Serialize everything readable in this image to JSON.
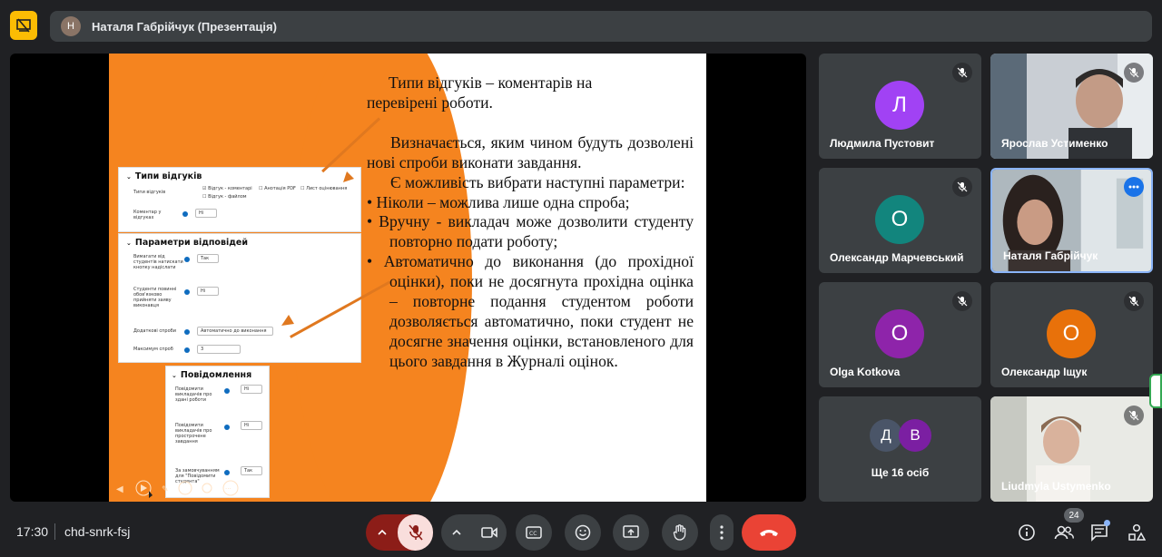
{
  "header": {
    "presenter_title": "Наталя Габрійчук (Презентація)",
    "presenting_icon": "stop-presenting-icon"
  },
  "slide": {
    "title_line1": "Типи відгуків – коментарів на",
    "title_line2": "перевірені роботи.",
    "para1": "Визначається, яким чином будуть дозволені нові спроби виконати завдання.",
    "para2": "Є можливість вибрати наступні параметри:",
    "bullets": [
      "•   Ніколи – можлива лише одна спроба;",
      "•   Вручну - викладач може дозволити студенту повторно подати роботу;",
      "•   Автоматично до виконання (до прохідної оцінки), поки не досягнута прохідна оцінка – повторне подання студентом роботи дозволяється автоматично, поки студент не досягне значення оцінки, встановленого для цього завдання в Журналі оцінок."
    ],
    "panel1": {
      "header": "Типи відгуків",
      "row1_label": "Типи відгуків",
      "check1": "Відгук - коментарі",
      "check2": "Анотація PDF",
      "check3": "Лист оцінювання",
      "check4": "Відгук - файлом",
      "row2_label": "Коментар у відгуках",
      "row2_value": "Ні"
    },
    "panel2": {
      "header": "Параметри відповідей",
      "row1_label": "Вимагати від студентів натискати кнопку надіслати",
      "row1_value": "Так",
      "row2_label": "Студенти повинні обов'язково прийняти заяву виконавця",
      "row2_value": "Ні",
      "row3_label": "Додаткові спроби",
      "row3_value": "Автоматично до виконання",
      "row4_label": "Максимум спроб",
      "row4_value": "3"
    },
    "panel3": {
      "header": "Повідомлення",
      "row1_label": "Повідомити викладачів про здані роботи",
      "row1_value": "Ні",
      "row2_label": "Повідомити викладачів про прострочене завдання",
      "row2_value": "Ні",
      "row3_label": "За замовчуванням для \"Повідомити студента\"",
      "row3_value": "Так"
    }
  },
  "participants": [
    {
      "name": "Людмила Пустовит",
      "initial": "Л",
      "color": "#a142f4",
      "muted": true
    },
    {
      "name": "Ярослав Устименко",
      "video": true,
      "muted": true
    },
    {
      "name": "Олександр Марчевський",
      "initial": "О",
      "color": "#12857d",
      "muted": true
    },
    {
      "name": "Наталя Габрійчук",
      "video": true,
      "active": true
    },
    {
      "name": "Olga Kotkova",
      "initial": "O",
      "color": "#8e24aa",
      "muted": true
    },
    {
      "name": "Олександр Іщук",
      "initial": "О",
      "color": "#e8710a",
      "muted": true
    },
    {
      "name": "Ще 16 осіб",
      "initials": [
        "Д",
        "В"
      ]
    },
    {
      "name": "Liudmyla Ustymenko",
      "video": true,
      "muted": true
    }
  ],
  "footer": {
    "time": "17:30",
    "meeting_code": "chd-snrk-fsj",
    "participant_count": "24"
  },
  "colors": {
    "background": "#202124",
    "tile": "#3c4043",
    "accent": "#8ab4f8",
    "end_call": "#ea4335",
    "slide_orange": "#f5841f"
  }
}
